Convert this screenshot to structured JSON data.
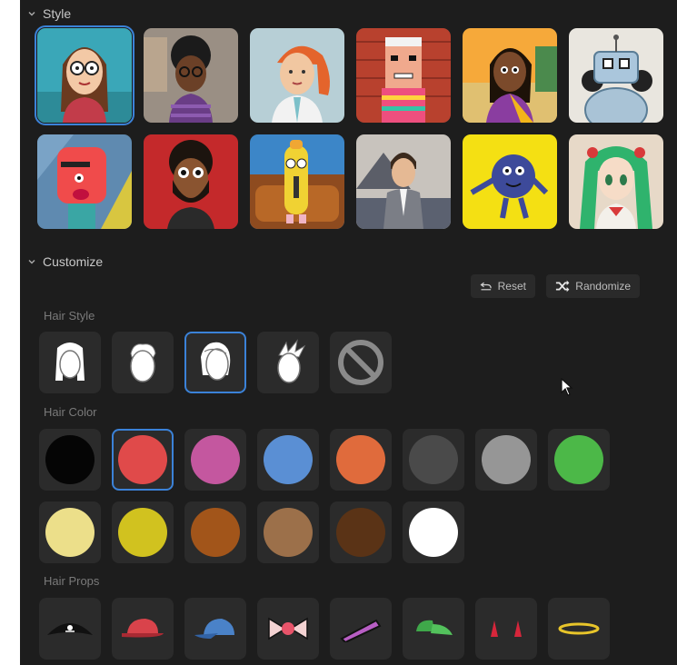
{
  "style_section": {
    "title": "Style"
  },
  "customize_section": {
    "title": "Customize",
    "reset_label": "Reset",
    "randomize_label": "Randomize"
  },
  "hair_style": {
    "label": "Hair Style",
    "selected_index": 2,
    "options": [
      "hair-style-1",
      "hair-style-2",
      "hair-style-3",
      "hair-style-4",
      "none"
    ]
  },
  "hair_color": {
    "label": "Hair Color",
    "selected_index": 1,
    "colors": [
      "#050505",
      "#e04a4a",
      "#c4579f",
      "#5a8fd4",
      "#e06b3c",
      "#4a4a4a",
      "#969696",
      "#4cb848",
      "#ecdf8a",
      "#d1c21f",
      "#a2551a",
      "#9c704a",
      "#5a3316",
      "#ffffff"
    ]
  },
  "hair_props": {
    "label": "Hair Props",
    "items": [
      "pirate-hat-icon",
      "red-cap-icon",
      "blue-cap-icon",
      "bow-icon",
      "hair-pin-icon",
      "green-cap-icon",
      "devil-horns-icon",
      "halo-icon"
    ]
  },
  "styles": [
    "woman-glasses",
    "man-curly-hair",
    "redhead-doctor",
    "man-checkered-shirt",
    "woman-saree",
    "robot",
    "red-blob",
    "bearded-man",
    "yellow-fry",
    "man-suit",
    "blue-ball-creature",
    "anime-girl"
  ],
  "colors": {
    "accent": "#3b82d8",
    "panel_bg": "#1d1d1d",
    "tile_bg": "#2b2b2b"
  }
}
